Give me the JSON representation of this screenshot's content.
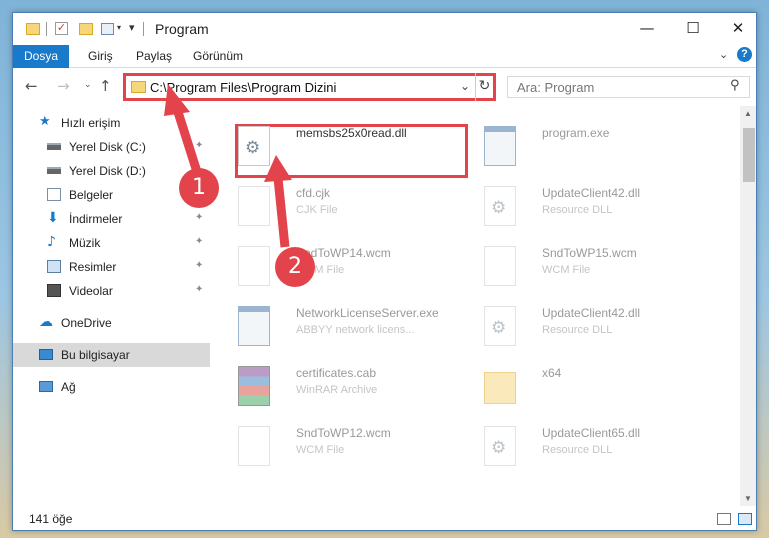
{
  "window": {
    "title": "Program",
    "minimize_glyph": "—",
    "maximize_glyph": "☐",
    "close_glyph": "✕"
  },
  "ribbon": {
    "tabs": [
      {
        "label": "Dosya",
        "active": true
      },
      {
        "label": "Giriş"
      },
      {
        "label": "Paylaş"
      },
      {
        "label": "Görünüm"
      }
    ],
    "help_glyph": "?"
  },
  "navigation": {
    "back_glyph": "←",
    "forward_glyph": "→",
    "recent_glyph": "⌄",
    "up_glyph": "↑"
  },
  "address_bar": {
    "path": "C:\\Program Files\\Program Dizini",
    "dropdown_glyph": "⌄",
    "refresh_glyph": "↻"
  },
  "search": {
    "placeholder": "Ara: Program",
    "icon_glyph": "⚲"
  },
  "sidebar": {
    "items": [
      {
        "label": "Hızlı erişim",
        "icon": "star-icon"
      },
      {
        "label": "Yerel Disk (C:)",
        "icon": "drive-icon",
        "pinned": true
      },
      {
        "label": "Yerel Disk (D:)",
        "icon": "drive-icon"
      },
      {
        "label": "Belgeler",
        "icon": "documents-icon"
      },
      {
        "label": "İndirmeler",
        "icon": "download-icon",
        "pinned": true
      },
      {
        "label": "Müzik",
        "icon": "music-icon",
        "pinned": true
      },
      {
        "label": "Resimler",
        "icon": "pictures-icon",
        "pinned": true
      },
      {
        "label": "Videolar",
        "icon": "videos-icon",
        "pinned": true
      },
      {
        "label": "OneDrive",
        "icon": "cloud-icon"
      },
      {
        "label": "Bu bilgisayar",
        "icon": "computer-icon",
        "selected": true
      },
      {
        "label": "Ağ",
        "icon": "network-icon"
      }
    ],
    "pin_glyph": "📌"
  },
  "files": [
    {
      "name": "memsbs25x0read.dll",
      "type": "",
      "icon": "dll-gear-icon",
      "highlighted": true
    },
    {
      "name": "program.exe",
      "type": "",
      "icon": "exe-icon"
    },
    {
      "name": "cfd.cjk",
      "type": "CJK File",
      "icon": "blank-file-icon"
    },
    {
      "name": "UpdateClient42.dll",
      "type": "Resource DLL",
      "icon": "dll-gear-icon"
    },
    {
      "name": "SndToWP14.wcm",
      "type": "WCM File",
      "icon": "blank-file-icon"
    },
    {
      "name": "SndToWP15.wcm",
      "type": "WCM File",
      "icon": "blank-file-icon"
    },
    {
      "name": "NetworkLicenseServer.exe",
      "type": "ABBYY network licens...",
      "icon": "exe-icon"
    },
    {
      "name": "UpdateClient42.dll",
      "type": "Resource DLL",
      "icon": "dll-gear-icon"
    },
    {
      "name": "certificates.cab",
      "type": "WinRAR Archive",
      "icon": "rar-icon"
    },
    {
      "name": "x64",
      "type": "",
      "icon": "folder-icon"
    },
    {
      "name": "SndToWP12.wcm",
      "type": "WCM File",
      "icon": "blank-file-icon"
    },
    {
      "name": "UpdateClient65.dll",
      "type": "Resource DLL",
      "icon": "dll-gear-icon"
    }
  ],
  "status": {
    "item_count": "141 öğe"
  },
  "callouts": [
    {
      "number": "1"
    },
    {
      "number": "2"
    }
  ],
  "colors": {
    "accent": "#1979ca",
    "highlight": "#e3434b"
  }
}
